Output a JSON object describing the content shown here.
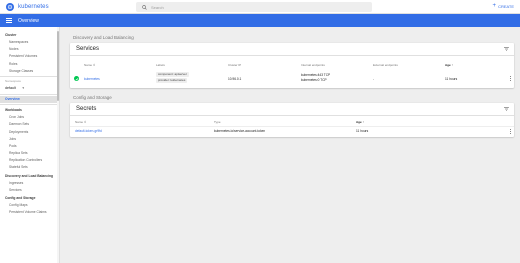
{
  "topbar": {
    "brand": "kubernetes",
    "search_placeholder": "Search",
    "create_label": "CREATE"
  },
  "header": {
    "title": "Overview"
  },
  "sidebar": {
    "cluster_heading": "Cluster",
    "cluster_items": [
      "Namespaces",
      "Nodes",
      "Persistent Volumes",
      "Roles",
      "Storage Classes"
    ],
    "namespace_label": "Namespace",
    "namespace_value": "default",
    "overview": "Overview",
    "workloads_heading": "Workloads",
    "workloads_items": [
      "Cron Jobs",
      "Daemon Sets",
      "Deployments",
      "Jobs",
      "Pods",
      "Replica Sets",
      "Replication Controllers",
      "Stateful Sets"
    ],
    "discovery_heading": "Discovery and Load Balancing",
    "discovery_items": [
      "Ingresses",
      "Services"
    ],
    "config_heading": "Config and Storage",
    "config_items": [
      "Config Maps",
      "Persistent Volume Claims"
    ]
  },
  "discovery": {
    "section_title": "Discovery and Load Balancing",
    "services": {
      "title": "Services",
      "columns": {
        "name": "Name",
        "labels": "Labels",
        "cluster_ip": "Cluster IP",
        "internal_endpoints": "Internal endpoints",
        "external_endpoints": "External endpoints",
        "age": "Age"
      },
      "rows": [
        {
          "name": "kubernetes",
          "labels": [
            "component: apiserver",
            "provider: kubernetes"
          ],
          "cluster_ip": "10.96.0.1",
          "internal_endpoints": [
            "kubernetes:443 TCP",
            "kubernetes:0 TCP"
          ],
          "external_endpoints": "-",
          "age": "11 hours"
        }
      ]
    }
  },
  "config": {
    "section_title": "Config and Storage",
    "secrets": {
      "title": "Secrets",
      "columns": {
        "name": "Name",
        "type": "Type",
        "age": "Age"
      },
      "rows": [
        {
          "name": "default-token-gr9fd",
          "type": "kubernetes.io/service-account-token",
          "age": "11 hours"
        }
      ]
    }
  },
  "icons": {
    "logo": "kubernetes-logo-icon",
    "menu": "menu-icon",
    "search": "search-icon",
    "add": "add-icon",
    "filter": "filter-icon",
    "status": "check-circle-icon",
    "more": "more-vert-icon"
  },
  "colors": {
    "accent": "#326de6",
    "status_ok": "#00c752"
  }
}
